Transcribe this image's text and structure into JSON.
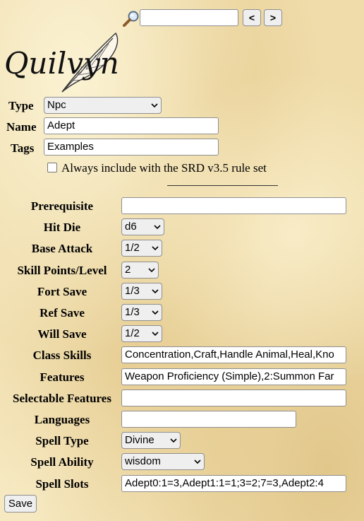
{
  "search": {
    "value": "",
    "icon": "magnifier-icon"
  },
  "nav": {
    "prev_label": "<",
    "next_label": ">"
  },
  "logo": {
    "text": "Quilvyn",
    "icon": "quill-feather-icon"
  },
  "header_fields": {
    "type": {
      "label": "Type",
      "value": "Npc"
    },
    "name": {
      "label": "Name",
      "value": "Adept"
    },
    "tags": {
      "label": "Tags",
      "value": "Examples"
    },
    "always_include": {
      "label": "Always include with the SRD v3.5 rule set",
      "checked": false
    }
  },
  "class_fields": {
    "prerequisite": {
      "label": "Prerequisite",
      "value": ""
    },
    "hit_die": {
      "label": "Hit Die",
      "value": "d6"
    },
    "base_attack": {
      "label": "Base Attack",
      "value": "1/2"
    },
    "skill_points": {
      "label": "Skill Points/Level",
      "value": "2"
    },
    "fort_save": {
      "label": "Fort Save",
      "value": "1/3"
    },
    "ref_save": {
      "label": "Ref Save",
      "value": "1/3"
    },
    "will_save": {
      "label": "Will Save",
      "value": "1/2"
    },
    "class_skills": {
      "label": "Class Skills",
      "value": "Concentration,Craft,Handle Animal,Heal,Kno"
    },
    "features": {
      "label": "Features",
      "value": "Weapon Proficiency (Simple),2:Summon Far"
    },
    "selectable_features": {
      "label": "Selectable Features",
      "value": ""
    },
    "languages": {
      "label": "Languages",
      "value": ""
    },
    "spell_type": {
      "label": "Spell Type",
      "value": "Divine"
    },
    "spell_ability": {
      "label": "Spell Ability",
      "value": "wisdom"
    },
    "spell_slots": {
      "label": "Spell Slots",
      "value": "Adept0:1=3,Adept1:1=1;3=2;7=3,Adept2:4"
    }
  },
  "save_label": "Save"
}
